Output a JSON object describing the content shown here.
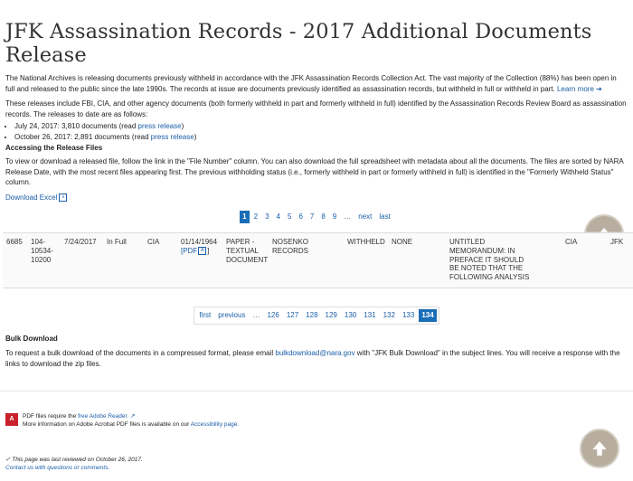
{
  "title": "JFK Assassination Records - 2017 Additional Documents Release",
  "intro": {
    "text": "The National Archives is releasing documents previously withheld in accordance with the JFK Assassination Records Collection Act.  The vast majority of the Collection (88%) has been open in full and released to the public since the late 1990s. The records at issue are documents previously identified as assassination records, but withheld in full or withheld in part.",
    "learn_more": "Learn more ➔"
  },
  "releases_text": "These releases include FBI, CIA, and other agency documents (both formerly withheld in part and formerly withheld in full) identified by the Assassination Records Review Board as assassination records. The releases to date are as follows:",
  "releases": [
    {
      "text": "July 24, 2017: 3,810 documents (read ",
      "link": "press release",
      "close": ")"
    },
    {
      "text": "October 26, 2017: 2,891 documents (read ",
      "link": "press release",
      "close": ")"
    }
  ],
  "access_heading": "Accessing the Release Files",
  "access_text": "To view or download a released file, follow the link in the \"File Number\" column. You can also download the full spreadsheet with metadata about all the documents. The files are sorted by NARA Release Date, with the most recent files appearing first. The previous withholding status (i.e., formerly withheld in part or formerly withheld in full) is identified in the \"Formerly Withheld Status\" column.",
  "download_excel": "Download Excel",
  "pager_top": [
    "1",
    "2",
    "3",
    "4",
    "5",
    "6",
    "7",
    "8",
    "9",
    "…",
    "next",
    "last"
  ],
  "row": {
    "num": "6685",
    "file_number": "104-\n10534-\n10200",
    "release_date": "7/24/2017",
    "status": "In Full",
    "agency": "CIA",
    "doc_date": "01/14/1964",
    "pdf": "[PDF",
    "doc_type": "PAPER -\nTEXTUAL\nDOCUMENT",
    "title": "NOSENKO\nRECORDS",
    "withheld": "WITHHELD",
    "none": "NONE",
    "comment": "UNTITLED\nMEMORANDUM: IN\nPREFACE IT SHOULD\nBE NOTED THAT THE\nFOLLOWING ANALYSIS",
    "originator": "CIA",
    "jfk": "JFK"
  },
  "pager_bottom": [
    "first",
    "previous",
    "…",
    "126",
    "127",
    "128",
    "129",
    "130",
    "131",
    "132",
    "133",
    "134"
  ],
  "bulk_heading": "Bulk Download",
  "bulk_text_pre": "To request a bulk download of the documents in a compressed format, please email ",
  "bulk_email": "bulkdownload@nara.gov",
  "bulk_text_post": " with \"JFK Bulk Download\" in the subject lines. You will receive a response with the links to download the zip files.",
  "pdf_note": {
    "line1_pre": "PDF files require the ",
    "reader_link": "free Adobe Reader.",
    "line2_pre": "More information on Adobe Acrobat PDF files is available on our ",
    "access_link": "Accessibility page."
  },
  "reviewed": "This page was last reviewed on October 26, 2017.",
  "contact": "Contact us with questions or comments.",
  "colors": {
    "link": "#1a5ea8",
    "active_page": "#1a6eb8",
    "pdf_red": "#c8212b"
  }
}
